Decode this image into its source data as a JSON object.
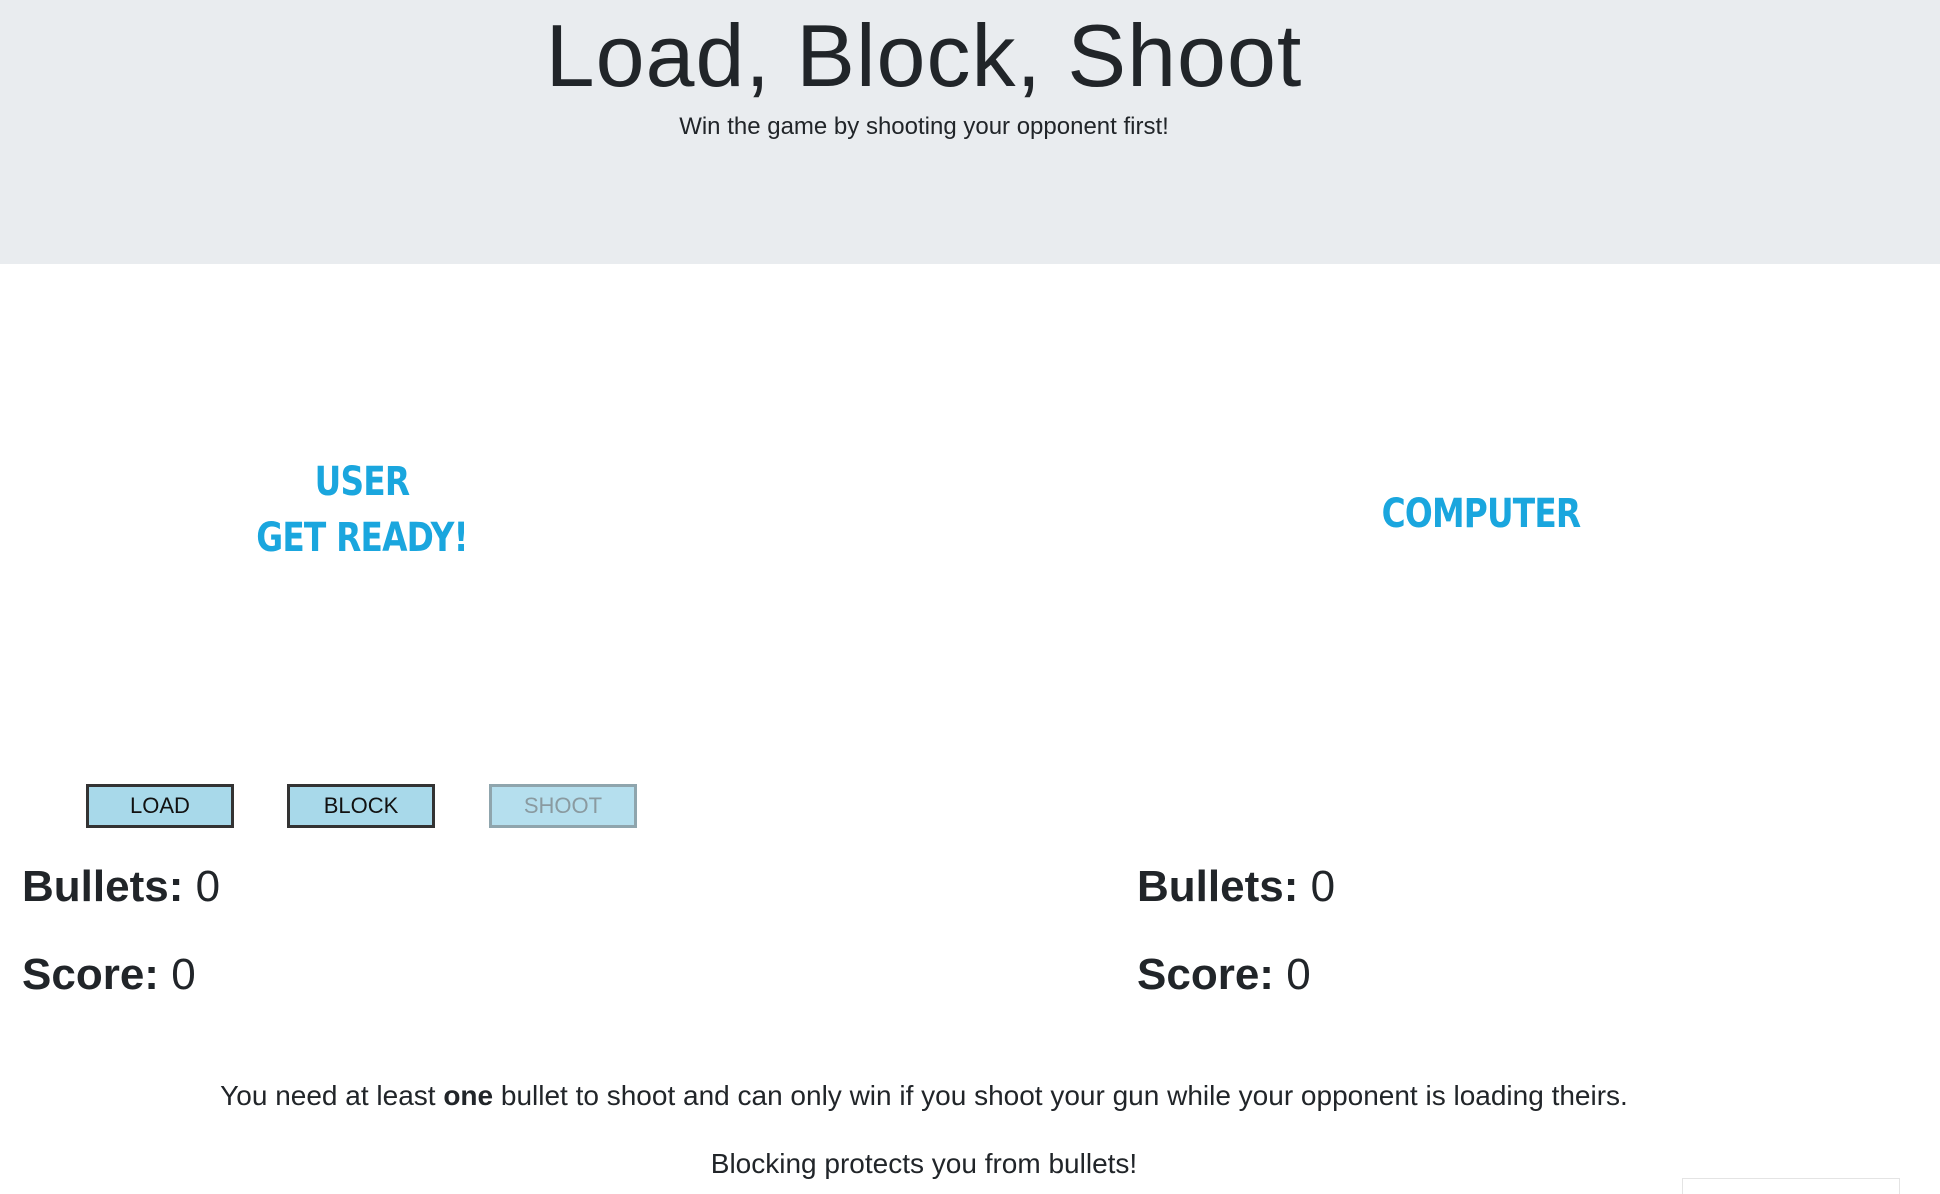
{
  "header": {
    "title": "Load, Block, Shoot",
    "subtitle": "Win the game by shooting your opponent first!"
  },
  "user": {
    "label_line1": "USER",
    "label_line2": "GET READY!",
    "bullets_label": "Bullets:",
    "bullets_value": "0",
    "score_label": "Score:",
    "score_value": "0"
  },
  "computer": {
    "label": "COMPUTER",
    "bullets_label": "Bullets:",
    "bullets_value": "0",
    "score_label": "Score:",
    "score_value": "0"
  },
  "controls": {
    "load_label": "LOAD",
    "block_label": "BLOCK",
    "shoot_label": "SHOOT"
  },
  "instructions": {
    "line1_before": "You need at least",
    "line1_bold": "one",
    "line1_after": "bullet to shoot and can only win if you shoot your gun while your opponent is loading theirs.",
    "line2": "Blocking protects you from bullets!"
  },
  "colors": {
    "header_bg": "#e9ecef",
    "accent": "#1aa6de",
    "button_bg": "#a8d9ea"
  }
}
